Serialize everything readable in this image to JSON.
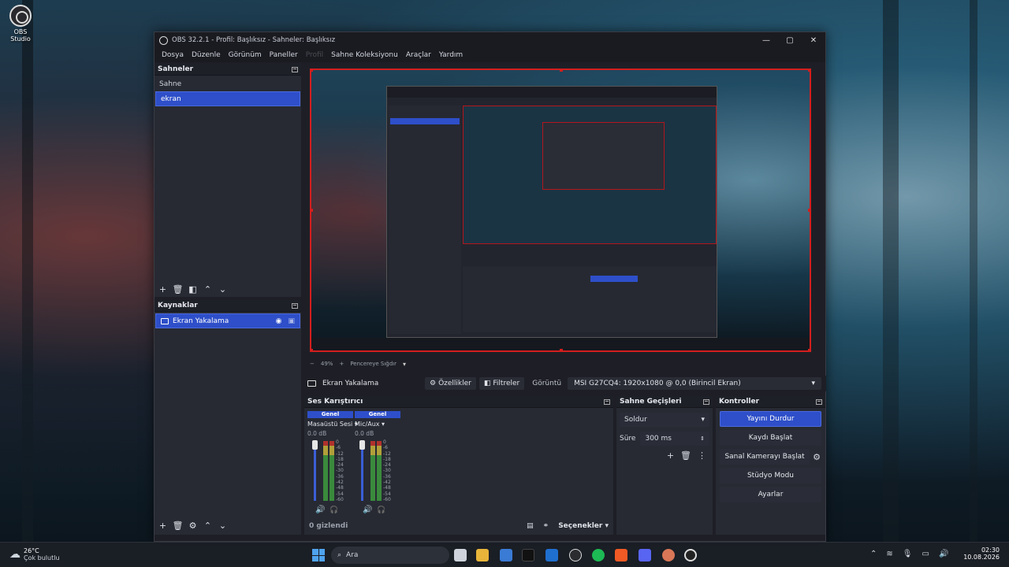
{
  "desktop": {
    "icon_label": "OBS Studio"
  },
  "window": {
    "title": "OBS 32.2.1 - Profil: Başlıksız - Sahneler: Başlıksız",
    "menu": [
      "Dosya",
      "Düzenle",
      "Görünüm",
      "Paneller",
      "Profil",
      "Sahne Koleksiyonu",
      "Araçlar",
      "Yardım"
    ]
  },
  "scenes": {
    "header": "Sahneler",
    "items": [
      "Sahne",
      "ekran"
    ],
    "selected": 1
  },
  "sources": {
    "header": "Kaynaklar",
    "items": [
      "Ekran Yakalama"
    ]
  },
  "preview": {
    "zoom": "49%",
    "mode": "Pencereye Sığdır",
    "sel_color": "#d41e1e"
  },
  "source_bar": {
    "name": "Ekran Yakalama",
    "props": "Özellikler",
    "filters": "Filtreler",
    "display_label": "Görüntü",
    "display_value": "MSI G27CQ4: 1920x1080 @ 0,0 (Birincil Ekran)"
  },
  "mixer": {
    "header": "Ses Karıştırıcı",
    "channels": [
      {
        "tag": "Genel",
        "name": "Masaüstü Sesi",
        "db": "0.0 dB"
      },
      {
        "tag": "Genel",
        "name": "Mic/Aux",
        "db": "0.0 dB"
      }
    ],
    "scale": [
      "0",
      "-6",
      "-12",
      "-18",
      "-24",
      "-30",
      "-36",
      "-42",
      "-48",
      "-54",
      "-60"
    ],
    "hidden": "0 gizlendi",
    "options": "Seçenekler"
  },
  "transitions": {
    "header": "Sahne Geçişleri",
    "type": "Soldur",
    "duration_label": "Süre",
    "duration": "300 ms"
  },
  "controls": {
    "header": "Kontroller",
    "buttons": [
      "Yayını Durdur",
      "Kaydı Başlat",
      "Sanal Kamerayı Başlat",
      "Stüdyo Modu",
      "Ayarlar"
    ],
    "accent": "#2e4fc9"
  },
  "taskbar": {
    "weather_temp": "26°C",
    "weather_desc": "Çok bulutlu",
    "search": "Ara",
    "time": "02:30",
    "date": "10.08.2026"
  }
}
